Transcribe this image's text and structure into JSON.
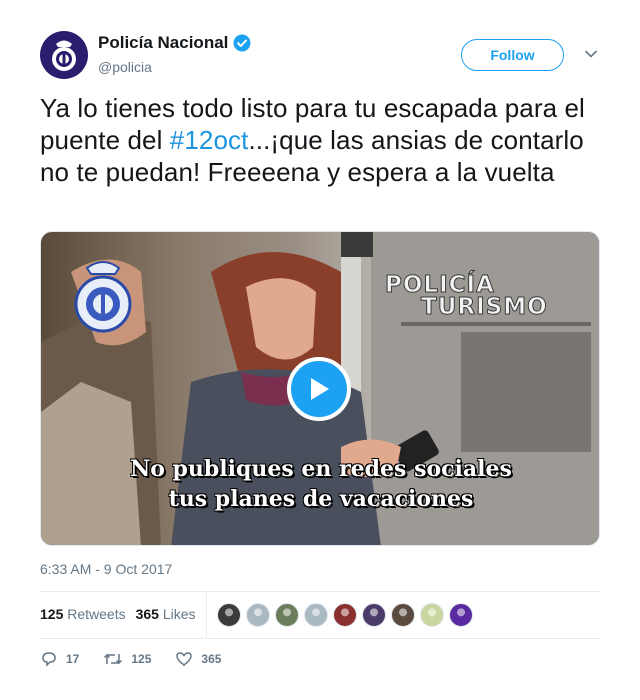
{
  "author": {
    "display_name": "Policía Nacional",
    "handle": "@policia",
    "verified": true,
    "avatar_icon": "police-badge-icon"
  },
  "follow_label": "Follow",
  "tweet": {
    "text_before": "Ya lo tienes todo listo para tu escapada para el puente del ",
    "hashtag": "#12oct",
    "text_after": "...¡que las ansias de contarlo no te puedan! Freeeena y espera a la vuelta"
  },
  "media": {
    "brand_line1": "POLICÍA",
    "brand_line2": "TURISMO",
    "caption_line1": "No publiques en redes sociales",
    "caption_line2": "tus planes de vacaciones",
    "play_icon": "play-icon"
  },
  "timestamp": "6:33 AM - 9 Oct 2017",
  "stats": {
    "retweets_count": "125",
    "retweets_label": "Retweets",
    "likes_count": "365",
    "likes_label": "Likes"
  },
  "likers_colors": [
    "#3b3b3b",
    "#aab8c2",
    "#6b7d5a",
    "#aab8c2",
    "#8a3030",
    "#4b3b6b",
    "#5a4a40",
    "#c9d6a0",
    "#5a2aa0"
  ],
  "actions": {
    "replies": "17",
    "retweets": "125",
    "likes": "365"
  },
  "colors": {
    "accent": "#1da1f2",
    "hashtag": "#1b95e0",
    "muted": "#657786"
  }
}
